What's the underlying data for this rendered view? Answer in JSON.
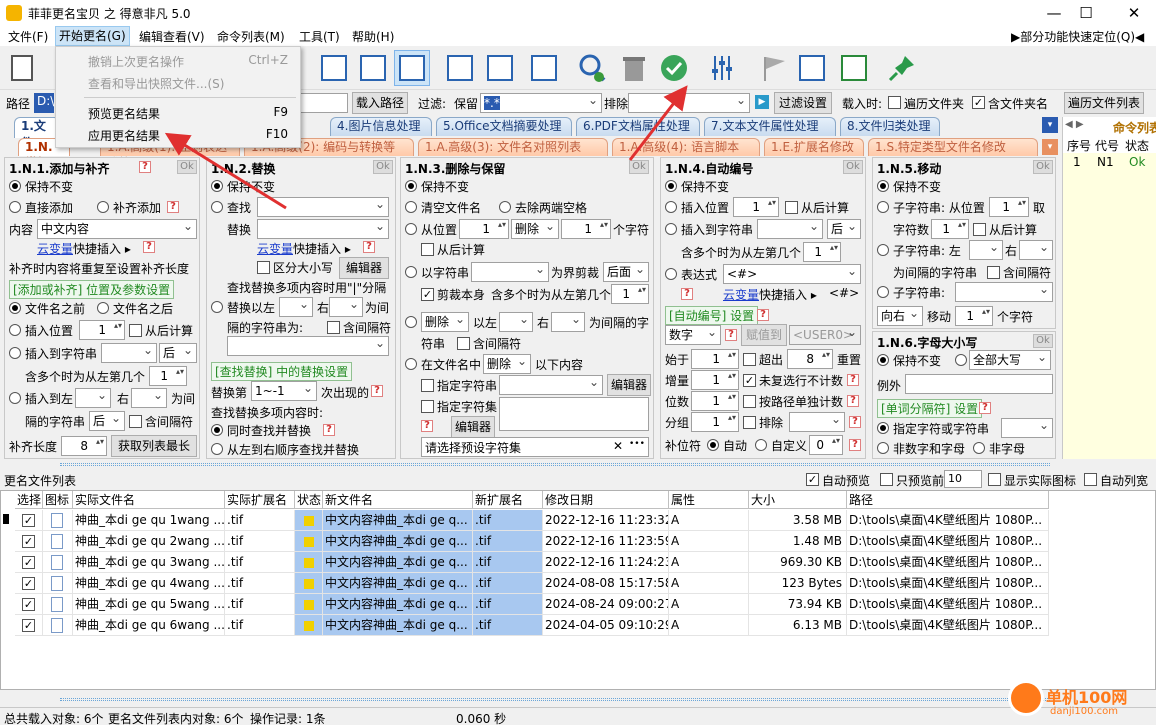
{
  "window": {
    "title": "菲菲更名宝贝 之 得意非凡 5.0",
    "minimize": "—",
    "maximize": "☐",
    "close": "✕"
  },
  "menu": {
    "file": "文件(F)",
    "rename": "开始更名(G)",
    "edit": "编辑查看(V)",
    "cmdlist": "命令列表(M)",
    "tools": "工具(T)",
    "help": "帮助(H)",
    "quicklocate": "▶部分功能快速定位(Q)◀"
  },
  "dropdown": {
    "undo": "撤销上次更名操作",
    "undo_key": "Ctrl+Z",
    "snapshot": "查看和导出快照文件...(S)",
    "preview": "预览更名结果",
    "preview_key": "F9",
    "apply": "应用更名结果",
    "apply_key": "F10"
  },
  "pathbar": {
    "path_label": "路径",
    "path_value": "D:\\",
    "load_btn": "载入路径",
    "filter_label": "过滤:",
    "keep_label": "保留",
    "keep_value": "*.*",
    "exclude_label": "排除",
    "filter_settings": "过滤设置",
    "loadtime": "载入时:",
    "traverse_folder": "遍历文件夹",
    "include_folder": "含文件夹名",
    "traverse_list": "遍历文件列表"
  },
  "tabs1": [
    "1.文件",
    "4.图片信息处理",
    "5.Office文档摘要处理",
    "6.PDF文档属性处理",
    "7.文本文件属性处理",
    "8.文件归类处理"
  ],
  "tabs2": [
    "1.N.常规",
    "1.A.高级(1): 正则表达式等",
    "1.A.高级(2): 编码与转换等",
    "1.A.高级(3): 文件名对照列表",
    "1.A.高级(4): 语言脚本",
    "1.E.扩展名修改",
    "1.S.特定类型文件名修改"
  ],
  "ok": "Ok",
  "p1": {
    "title": "1.N.1.添加与补齐",
    "keep": "保持不变",
    "direct": "直接添加",
    "pad": "补齐添加",
    "content_label": "内容",
    "content_value": "中文内容",
    "var": "云变量",
    "quick": "快捷插入 ▸",
    "pad_note": "补齐时内容将重复至设置补齐长度",
    "sect": "[添加或补齐] 位置及参数设置",
    "before": "文件名之前",
    "after": "文件名之后",
    "insert_pos": "插入位置",
    "insert_pos_val": "1",
    "from_end": "从后计算",
    "insert_to_str": "插入到字符串",
    "after_opt": "后",
    "max_occ": "含多个时为从左第几个",
    "max_occ_val": "1",
    "insert_left": "插入到左",
    "right": "右",
    "between": "为间",
    "sep": "隔的字符串",
    "sep_opt": "后",
    "contains_sep": "含间隔符",
    "pad_len": "补齐长度",
    "pad_len_val": "8",
    "get_max": "获取列表最长"
  },
  "p2": {
    "title": "1.N.2.替换",
    "keep": "保持不变",
    "find": "查找",
    "replace": "替换",
    "var": "云变量",
    "quick": "快捷插入 ▸",
    "case": "区分大小写",
    "editor": "编辑器",
    "multi_note": "查找替换多项内容时用\"|\"分隔",
    "replace_left": "替换以左",
    "right": "右",
    "between": "为间",
    "sep": "隔的字符串为:",
    "contains_sep": "含间隔符",
    "sect": "[查找替换] 中的替换设置",
    "replace_nth": "替换第",
    "nth_val": "1~-1",
    "nth_suffix": "次出现的",
    "multi_label": "查找替换多项内容时:",
    "simul": "同时查找并替换",
    "seq": "从左到右顺序查找并替换"
  },
  "p3": {
    "title": "1.N.3.删除与保留",
    "keep": "保持不变",
    "clear": "清空文件名",
    "trim": "去除两端空格",
    "from_pos": "从位置",
    "from_pos_val": "1",
    "del_opt": "删除",
    "count_val": "1",
    "chars": "个字符",
    "from_end": "从后计算",
    "by_str": "以字符串",
    "boundary": "为界剪裁",
    "back_opt": "后面",
    "cut_self": "剪裁本身",
    "max_occ": "含多个时为从左第几个",
    "max_occ_val": "1",
    "del_opt2": "删除",
    "left": "以左",
    "right": "右",
    "between": "为间隔的字",
    "str": "符串",
    "contains_sep": "含间隔符",
    "in_name": "在文件名中",
    "del_opt3": "删除",
    "below": "以下内容",
    "spec_str": "指定字符串",
    "spec_set": "指定字符集",
    "editor": "编辑器",
    "preset": "请选择预设字符集",
    "preset_x": "✕",
    "preset_more": "•••"
  },
  "p4": {
    "title": "1.N.4.自动编号",
    "keep": "保持不变",
    "insert_pos": "插入位置",
    "insert_pos_val": "1",
    "from_end": "从后计算",
    "insert_to_str": "插入到字符串",
    "after_opt": "后",
    "max_occ": "含多个时为从左第几个",
    "max_occ_val": "1",
    "expr": "表达式",
    "expr_val": "<#>",
    "var": "云变量",
    "quick": "快捷插入 ▸",
    "hash": "<#>",
    "sect": "[自动编号] 设置",
    "type": "数字",
    "assign": "赋值到",
    "user": "<USER0>",
    "start": "始于",
    "start_val": "1",
    "exceed": "超出",
    "exceed_val": "8",
    "reset": "重置",
    "step": "增量",
    "step_val": "1",
    "no_repeat": "未复选行不计数",
    "digits": "位数",
    "digits_val": "1",
    "by_path": "按路径单独计数",
    "group": "分组",
    "group_val": "1",
    "exclude": "排除",
    "padchar": "补位符",
    "auto": "自动",
    "custom": "自定义",
    "custom_val": "0"
  },
  "p5": {
    "title": "1.N.5.移动",
    "keep": "保持不变",
    "substr_from": "子字符串: 从位置",
    "pos_val": "1",
    "take": "取",
    "count": "字符数",
    "count_val": "1",
    "from_end": "从后计算",
    "substr_left": "子字符串: 左",
    "right": "右",
    "between_str": "为间隔的字符串",
    "contains_sep": "含间隔符",
    "substr": "子字符串:",
    "dir": "向右",
    "move": "移动",
    "move_val": "1",
    "chars": "个字符"
  },
  "p6": {
    "title": "1.N.6.字母大小写",
    "keep": "保持不变",
    "allcaps": "全部大写",
    "except": "例外",
    "sect": "[单词分隔符] 设置",
    "spec": "指定字符或字符串",
    "nonalnum": "非数字和字母",
    "nonchar": "非字母"
  },
  "rightlist": {
    "tab": "命令列表",
    "cols": [
      "序号",
      "代号",
      "状态"
    ],
    "row": [
      "1",
      "N1",
      "Ok"
    ]
  },
  "list": {
    "title": "更名文件列表",
    "auto_preview": "自动预览",
    "only_first": "只预览前",
    "only_first_val": "10",
    "show_icon": "显示实际图标",
    "auto_width": "自动列宽",
    "headers": [
      "选择",
      "图标",
      "实际文件名",
      "实际扩展名",
      "状态",
      "新文件名",
      "新扩展名",
      "修改日期",
      "属性",
      "大小",
      "路径"
    ],
    "rows": [
      {
        "name": "神曲_本di ge qu 1wang ...",
        "ext": ".tif",
        "new": "中文内容神曲_本di ge q...",
        "newext": ".tif",
        "date": "2022-12-16 11:23:32",
        "attr": "A",
        "size": "3.58 MB",
        "path": "D:\\tools\\桌面\\4K壁纸图片 1080P..."
      },
      {
        "name": "神曲_本di ge qu 2wang ...",
        "ext": ".tif",
        "new": "中文内容神曲_本di ge q...",
        "newext": ".tif",
        "date": "2022-12-16 11:23:59",
        "attr": "A",
        "size": "1.48 MB",
        "path": "D:\\tools\\桌面\\4K壁纸图片 1080P..."
      },
      {
        "name": "神曲_本di ge qu 3wang ...",
        "ext": ".tif",
        "new": "中文内容神曲_本di ge q...",
        "newext": ".tif",
        "date": "2022-12-16 11:24:23",
        "attr": "A",
        "size": "969.30 KB",
        "path": "D:\\tools\\桌面\\4K壁纸图片 1080P..."
      },
      {
        "name": "神曲_本di ge qu 4wang ...",
        "ext": ".tif",
        "new": "中文内容神曲_本di ge q...",
        "newext": ".tif",
        "date": "2024-08-08 15:17:58",
        "attr": "A",
        "size": "123 Bytes",
        "path": "D:\\tools\\桌面\\4K壁纸图片 1080P..."
      },
      {
        "name": "神曲_本di ge qu 5wang ...",
        "ext": ".tif",
        "new": "中文内容神曲_本di ge q...",
        "newext": ".tif",
        "date": "2024-08-24 09:00:27",
        "attr": "A",
        "size": "73.94 KB",
        "path": "D:\\tools\\桌面\\4K壁纸图片 1080P..."
      },
      {
        "name": "神曲_本di ge qu 6wang ...",
        "ext": ".tif",
        "new": "中文内容神曲_本di ge q...",
        "newext": ".tif",
        "date": "2024-04-05 09:10:29",
        "attr": "A",
        "size": "6.13 MB",
        "path": "D:\\tools\\桌面\\4K壁纸图片 1080P..."
      }
    ]
  },
  "status": {
    "loaded": "总共载入对象: 6个",
    "inlist": "更名文件列表内对象: 6个",
    "ops": "操作记录: 1条",
    "time": "0.060 秒"
  },
  "watermark": {
    "site": "单机100网",
    "url": "danji100.com"
  }
}
